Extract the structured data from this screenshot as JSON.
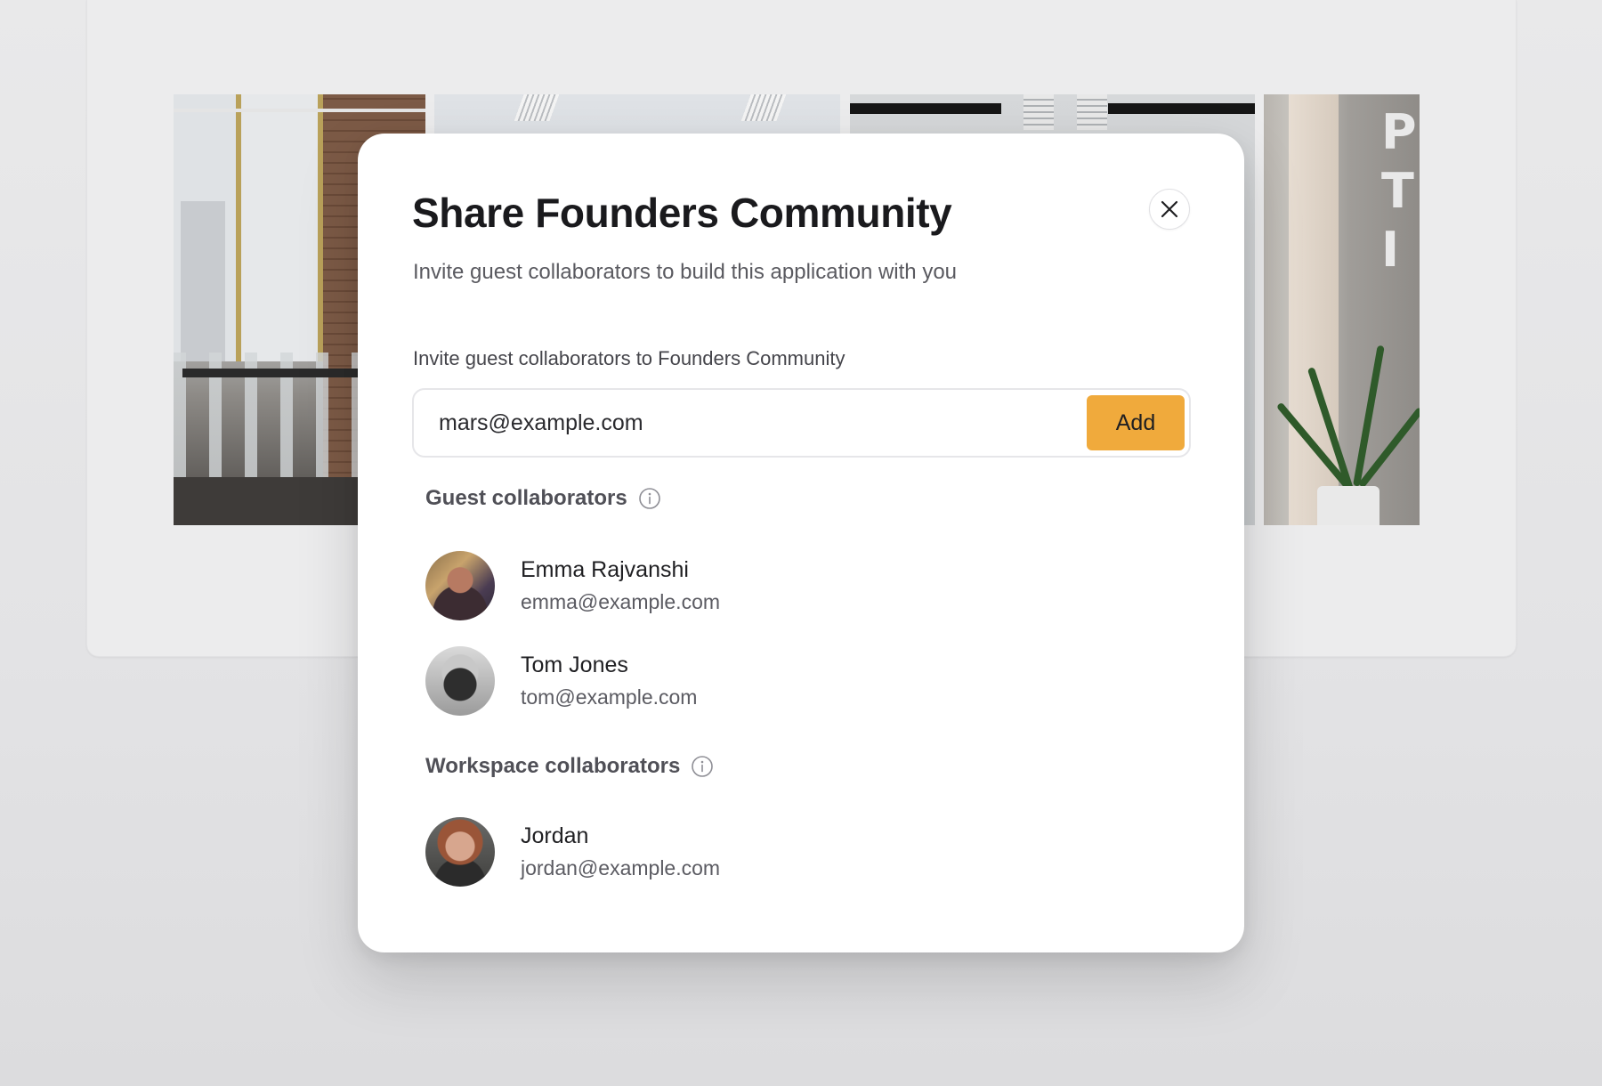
{
  "modal": {
    "title": "Share Founders Community",
    "subtitle": "Invite guest collaborators to build this application with you",
    "close_icon": "close-icon"
  },
  "invite": {
    "label": "Invite guest collaborators to Founders Community",
    "value": "mars@example.com",
    "add_label": "Add",
    "add_color": "#f0aa3c"
  },
  "guest_section": {
    "heading": "Guest collaborators",
    "icon": "info-icon",
    "people": [
      {
        "name": "Emma Rajvanshi",
        "email": "emma@example.com"
      },
      {
        "name": "Tom Jones",
        "email": "tom@example.com"
      }
    ]
  },
  "workspace_section": {
    "heading": "Workspace collaborators",
    "icon": "info-icon",
    "people": [
      {
        "name": "Jordan",
        "email": "jordan@example.com"
      }
    ]
  },
  "background": {
    "photo_letters": "P\nT\nI"
  }
}
